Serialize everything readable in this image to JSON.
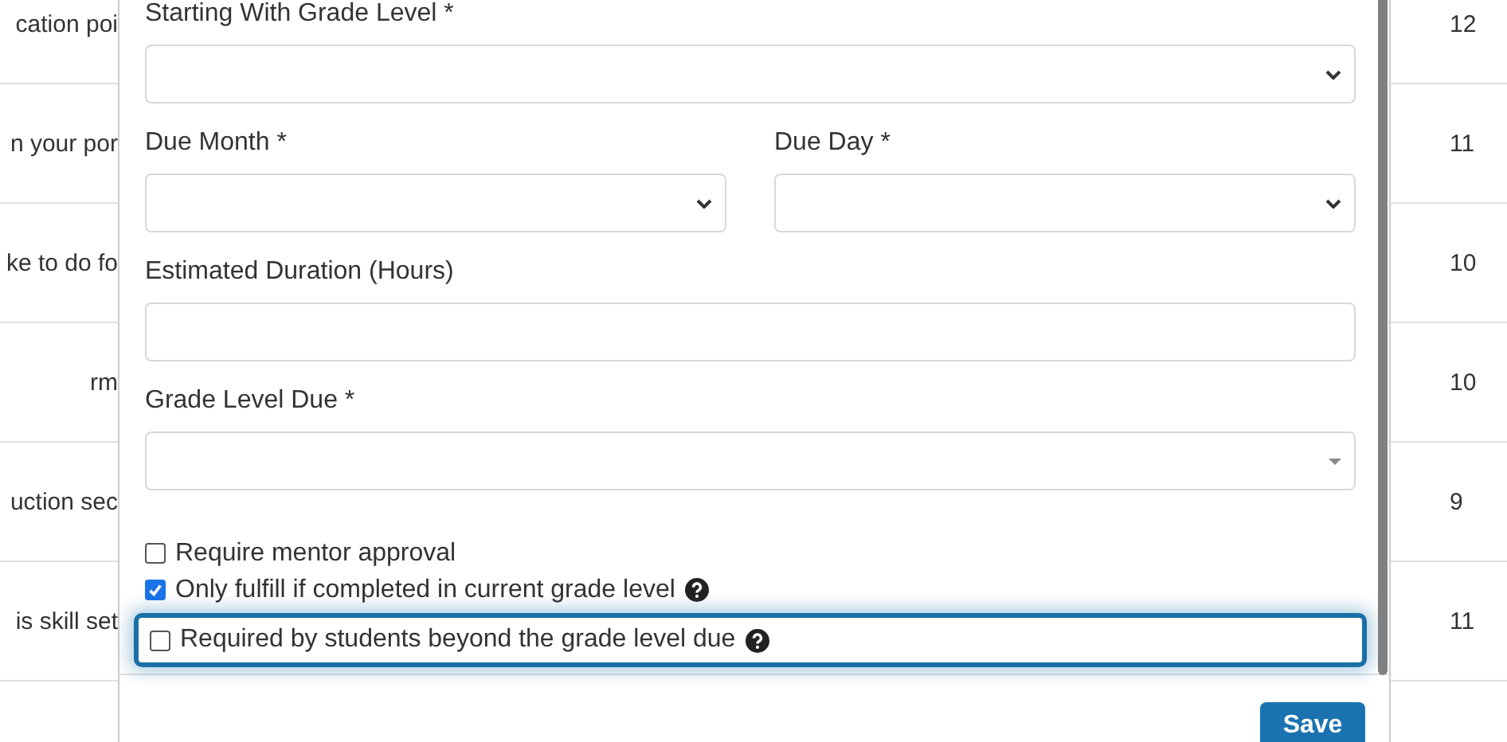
{
  "background_table": {
    "rows": [
      {
        "column_1": "cation poi",
        "column_2": "12"
      },
      {
        "column_1": "n your por",
        "column_2": "11"
      },
      {
        "column_1": "ke to do fo",
        "column_2": "10"
      },
      {
        "column_1": "rm",
        "column_2": "10"
      },
      {
        "column_1": "uction sec",
        "column_2": "9"
      },
      {
        "column_1": "is skill set",
        "column_2": "11"
      }
    ]
  },
  "dialog": {
    "fields": [
      {
        "kind": "select",
        "label": "Starting With Grade Level *"
      },
      {
        "kind": "select-pair",
        "items": [
          {
            "label": "Due Month *"
          },
          {
            "label": "Due Day *"
          }
        ]
      },
      {
        "kind": "input",
        "label": "Estimated Duration (Hours)"
      },
      {
        "kind": "combo",
        "label": "Grade Level Due *"
      }
    ],
    "checkboxes": [
      {
        "label": "Require mentor approval",
        "checked": false,
        "help": false,
        "focused": false
      },
      {
        "label": "Only fulfill if completed in current grade level",
        "checked": true,
        "help": true,
        "focused": false
      },
      {
        "label": "Required by students beyond the grade level due",
        "checked": false,
        "help": true,
        "focused": true
      }
    ],
    "save_button": "Save"
  }
}
